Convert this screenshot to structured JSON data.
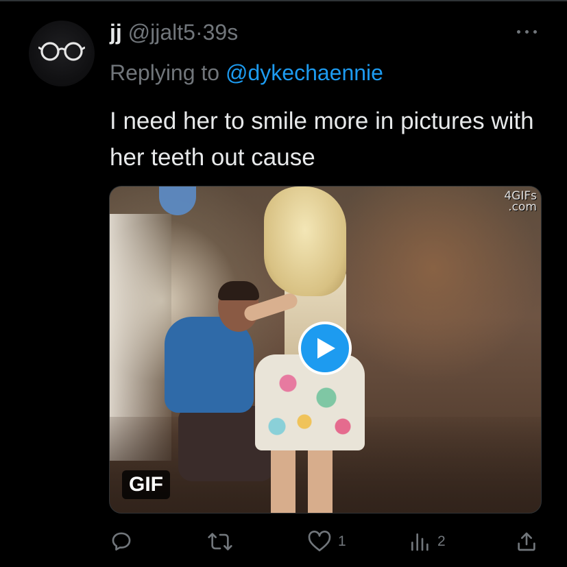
{
  "tweet": {
    "display_name": "jj",
    "handle": "@jjalt5",
    "separator": "·",
    "time": "39s",
    "replying_prefix": "Replying to",
    "replying_to": "@dykechaennie",
    "text": "I need her to smile more in pictures with her teeth out cause"
  },
  "media": {
    "watermark_line1": "4GIFs",
    "watermark_line2": ".com",
    "badge": "GIF"
  },
  "actions": {
    "reply_icon": "reply-icon",
    "retweet_icon": "retweet-icon",
    "like_icon": "heart-icon",
    "like_count": "1",
    "views_icon": "analytics-icon",
    "views_count": "2",
    "share_icon": "share-icon"
  },
  "colors": {
    "background": "#000000",
    "text": "#e7e9ea",
    "secondary": "#71767b",
    "accent": "#1d9bf0"
  }
}
